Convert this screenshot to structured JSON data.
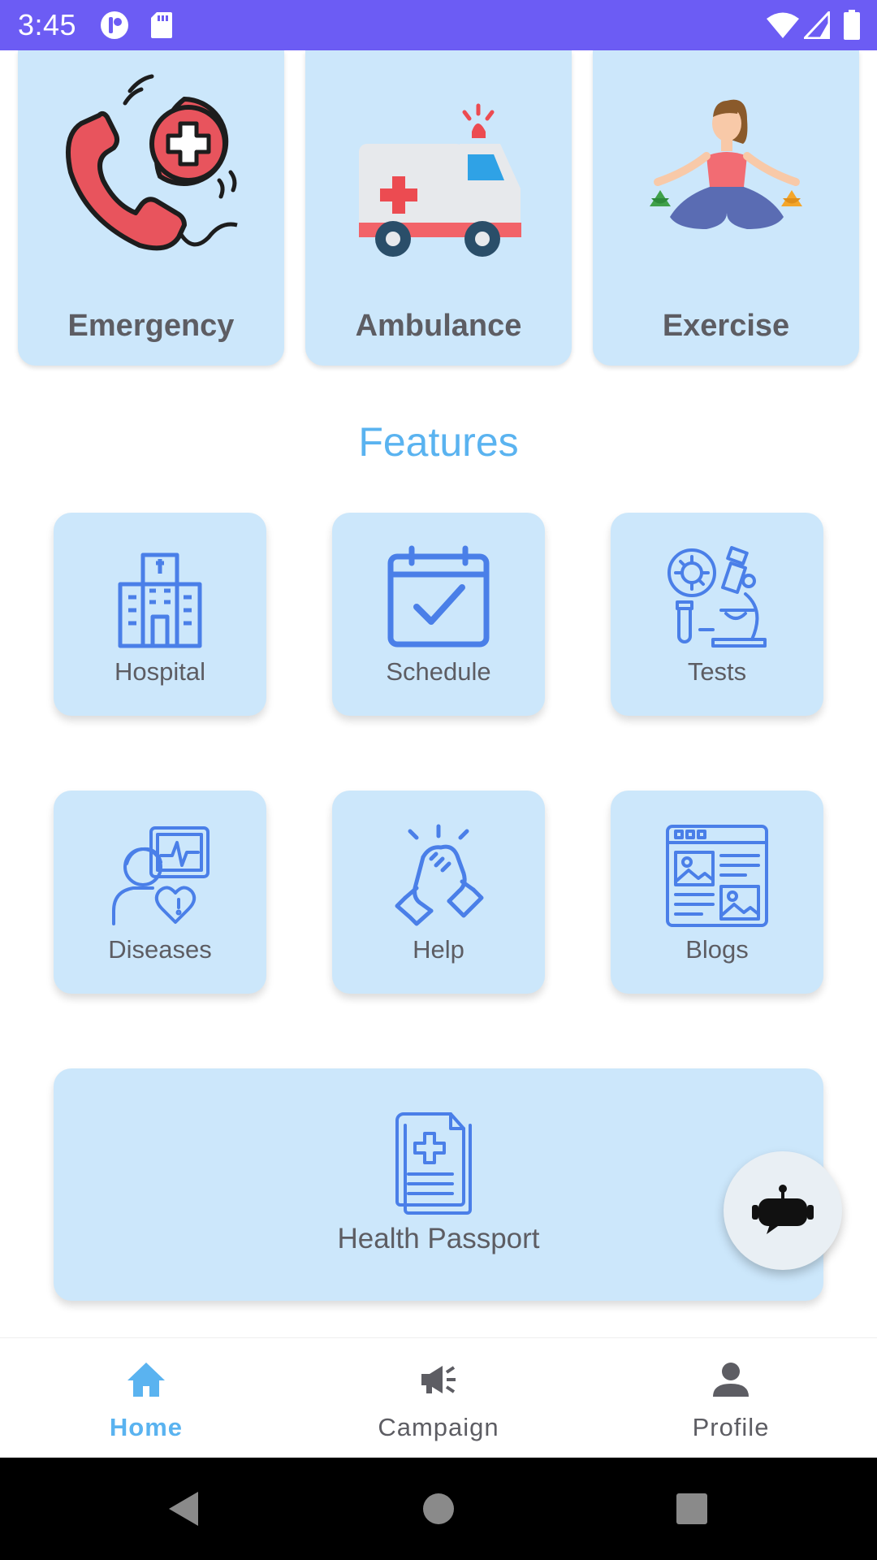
{
  "status_bar": {
    "time": "3:45",
    "icons": [
      "notification-icon",
      "sd-card-icon",
      "wifi-icon",
      "cell-signal-icon",
      "battery-icon"
    ],
    "background": "#6c5cf4"
  },
  "quick_actions": [
    {
      "label": "Emergency",
      "icon": "emergency-call-icon"
    },
    {
      "label": "Ambulance",
      "icon": "ambulance-icon"
    },
    {
      "label": "Exercise",
      "icon": "yoga-icon"
    }
  ],
  "features": {
    "title": "Features",
    "items": [
      {
        "label": "Hospital",
        "icon": "hospital-icon"
      },
      {
        "label": "Schedule",
        "icon": "calendar-check-icon"
      },
      {
        "label": "Tests",
        "icon": "microscope-icon"
      },
      {
        "label": "Diseases",
        "icon": "patient-heart-icon"
      },
      {
        "label": "Help",
        "icon": "handshake-icon"
      },
      {
        "label": "Blogs",
        "icon": "web-blog-icon"
      }
    ],
    "passport": {
      "label": "Health Passport",
      "icon": "medical-document-icon"
    }
  },
  "chat_button": {
    "icon": "chatbot-icon"
  },
  "bottom_nav": {
    "items": [
      {
        "label": "Home",
        "icon": "home-icon",
        "active": true
      },
      {
        "label": "Campaign",
        "icon": "megaphone-icon",
        "active": false
      },
      {
        "label": "Profile",
        "icon": "person-icon",
        "active": false
      }
    ]
  },
  "colors": {
    "accent": "#5ab3f0",
    "card": "#cce7fb",
    "icon_line": "#4a7fe8",
    "text": "#5d5d63"
  }
}
